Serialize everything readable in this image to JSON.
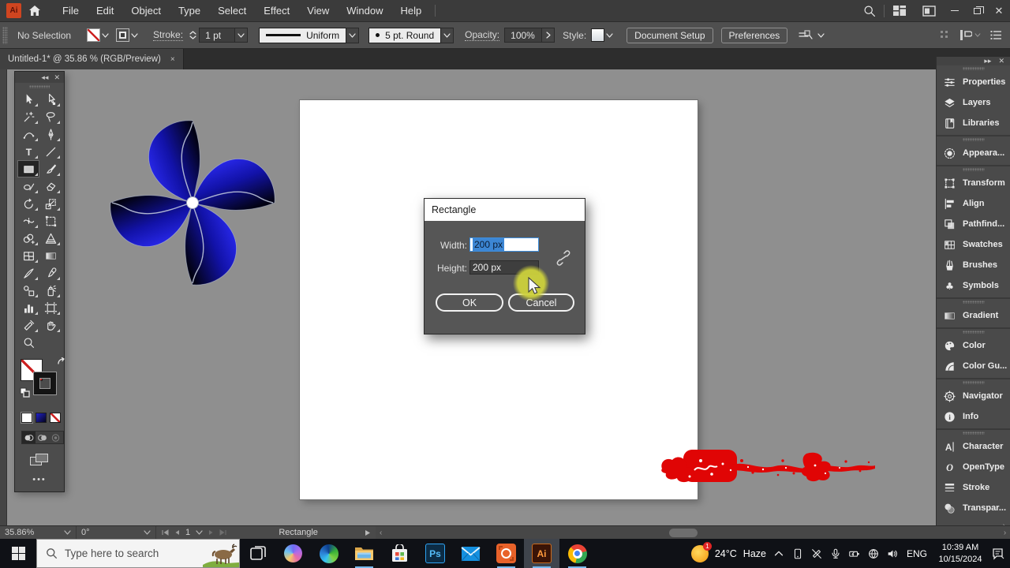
{
  "menubar": {
    "items": [
      "File",
      "Edit",
      "Object",
      "Type",
      "Select",
      "Effect",
      "View",
      "Window",
      "Help"
    ]
  },
  "controlbar": {
    "selection_status": "No Selection",
    "stroke_label": "Stroke:",
    "stroke_weight": "1 pt",
    "variable_width_profile": "Uniform",
    "brush_definition": "5 pt. Round",
    "opacity_label": "Opacity:",
    "opacity_value": "100%",
    "style_label": "Style:",
    "document_setup_label": "Document Setup",
    "preferences_label": "Preferences"
  },
  "tab": {
    "title": "Untitled-1* @ 35.86 % (RGB/Preview)",
    "close": "×"
  },
  "toolbar": {
    "active": "rectangle-tool",
    "rows": [
      [
        "selection-tool",
        "direct-selection-tool"
      ],
      [
        "magic-wand-tool",
        "lasso-tool"
      ],
      [
        "curvature-tool",
        "pen-tool"
      ],
      [
        "type-tool",
        "line-segment-tool"
      ],
      [
        "rectangle-tool",
        "paintbrush-tool"
      ],
      [
        "shaper-tool",
        "eraser-tool"
      ],
      [
        "rotate-tool",
        "scale-tool"
      ],
      [
        "width-tool",
        "free-transform-tool"
      ],
      [
        "shape-builder-tool",
        "perspective-grid-tool"
      ],
      [
        "mesh-tool",
        "gradient-tool"
      ],
      [
        "knife-tool",
        "eyedropper-tool"
      ],
      [
        "blend-tool",
        "symbol-sprayer-tool"
      ],
      [
        "graph-tool",
        "artboard-tool"
      ],
      [
        "slice-tool",
        "hand-tool"
      ],
      [
        "zoom-tool",
        null
      ]
    ]
  },
  "panels": {
    "groups": [
      {
        "items": [
          {
            "icon": "properties-icon",
            "label": "Properties"
          },
          {
            "icon": "layers-icon",
            "label": "Layers"
          },
          {
            "icon": "libraries-icon",
            "label": "Libraries"
          }
        ]
      },
      {
        "items": [
          {
            "icon": "appearance-icon",
            "label": "Appeara..."
          }
        ]
      },
      {
        "items": [
          {
            "icon": "transform-icon",
            "label": "Transform"
          },
          {
            "icon": "align-icon",
            "label": "Align"
          },
          {
            "icon": "pathfinder-icon",
            "label": "Pathfind..."
          },
          {
            "icon": "swatches-icon",
            "label": "Swatches"
          },
          {
            "icon": "brushes-icon",
            "label": "Brushes"
          },
          {
            "icon": "symbols-icon",
            "label": "Symbols"
          }
        ]
      },
      {
        "items": [
          {
            "icon": "gradient-icon",
            "label": "Gradient"
          }
        ]
      },
      {
        "items": [
          {
            "icon": "color-icon",
            "label": "Color"
          },
          {
            "icon": "color-guide-icon",
            "label": "Color Gu..."
          }
        ]
      },
      {
        "items": [
          {
            "icon": "navigator-icon",
            "label": "Navigator"
          },
          {
            "icon": "info-icon",
            "label": "Info"
          }
        ]
      },
      {
        "items": [
          {
            "icon": "character-icon",
            "label": "Character"
          },
          {
            "icon": "opentype-icon",
            "label": "OpenType"
          },
          {
            "icon": "stroke-icon",
            "label": "Stroke"
          },
          {
            "icon": "transparency-icon",
            "label": "Transpar..."
          }
        ]
      }
    ]
  },
  "dialog": {
    "title": "Rectangle",
    "width_label": "Width:",
    "width_value": "200 px",
    "height_label": "Height:",
    "height_value": "200 px",
    "ok_label": "OK",
    "cancel_label": "Cancel"
  },
  "statusbar": {
    "zoom": "35.86%",
    "rotation": "0°",
    "artboard_number": "1",
    "status_text": "Rectangle"
  },
  "taskbar": {
    "search_placeholder": "Type here to search",
    "apps": [
      {
        "name": "task-view",
        "open": false,
        "active": false
      },
      {
        "name": "copilot",
        "open": false,
        "active": false
      },
      {
        "name": "edge",
        "open": false,
        "active": false
      },
      {
        "name": "file-explorer",
        "open": true,
        "active": false
      },
      {
        "name": "microsoft-store",
        "open": false,
        "active": false
      },
      {
        "name": "photoshop",
        "open": false,
        "active": false
      },
      {
        "name": "mail",
        "open": false,
        "active": false
      },
      {
        "name": "screen-recorder",
        "open": true,
        "active": false
      },
      {
        "name": "illustrator",
        "open": true,
        "active": true
      },
      {
        "name": "chrome",
        "open": true,
        "active": false
      }
    ],
    "tray_icons": [
      "chevron-up-icon",
      "phone-link-icon",
      "pen-disabled-icon",
      "microphone-icon",
      "battery-icon",
      "network-globe-icon",
      "volume-icon"
    ],
    "weather_temp": "24°C",
    "weather_condition": "Haze",
    "language": "ENG",
    "time": "10:39 AM",
    "date": "10/15/2024"
  },
  "colors": {
    "selection_blue": "#3c86d4",
    "taskbar_underline": "#76b9ed",
    "artwork_blue_bright": "#2a2af0",
    "artwork_blue_dark": "#020216",
    "splatter_red": "#e00505",
    "cursor_highlight": "#cdd13c"
  }
}
